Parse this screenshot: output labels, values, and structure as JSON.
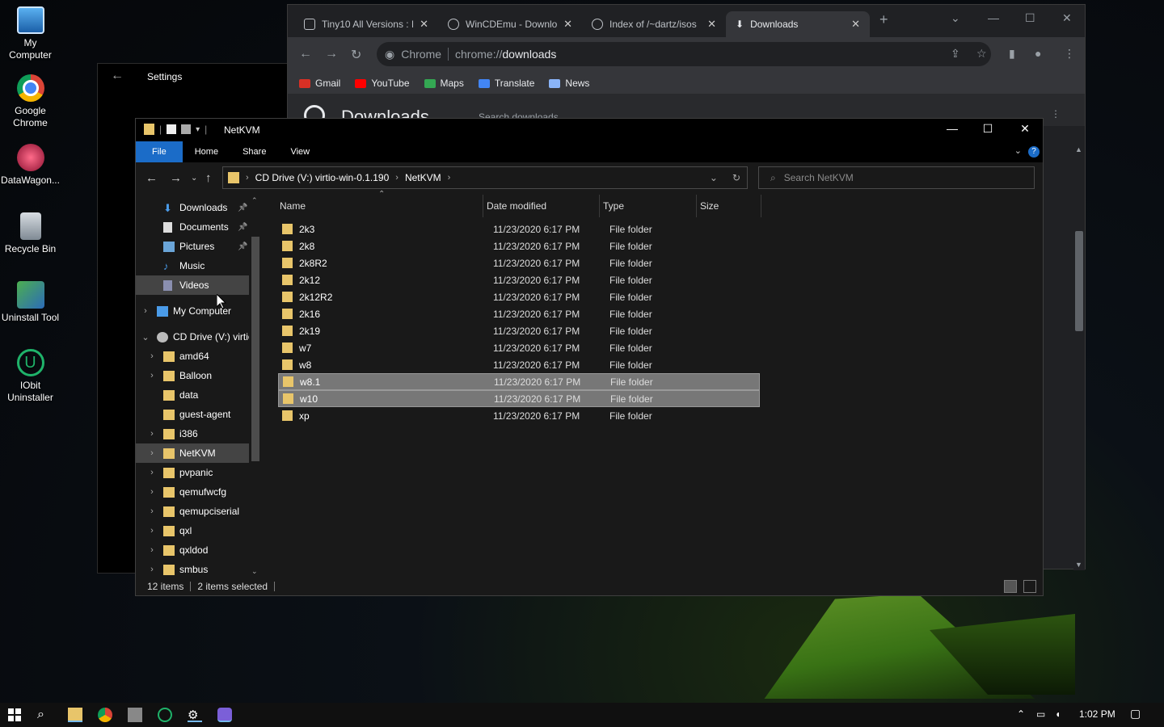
{
  "desktop": {
    "icons": [
      {
        "label_line1": "My",
        "label_line2": "Computer",
        "icon": "computer-icon"
      },
      {
        "label_line1": "Google",
        "label_line2": "Chrome",
        "icon": "chrome-icon"
      },
      {
        "label_line1": "DataWagon...",
        "label_line2": "",
        "icon": "datawagon-icon"
      },
      {
        "label_line1": "Recycle Bin",
        "label_line2": "",
        "icon": "recycle-bin-icon"
      },
      {
        "label_line1": "Uninstall Tool",
        "label_line2": "",
        "icon": "uninstall-tool-icon"
      },
      {
        "label_line1": "IObit",
        "label_line2": "Uninstaller",
        "icon": "iobit-icon"
      }
    ]
  },
  "settings": {
    "title": "Settings",
    "back": "←"
  },
  "chrome": {
    "tabs": [
      {
        "label": "Tiny10 All Versions : F",
        "close": "✕"
      },
      {
        "label": "WinCDEmu - Downlo",
        "close": "✕"
      },
      {
        "label": "Index of /~dartz/isos",
        "close": "✕"
      },
      {
        "label": "Downloads",
        "close": "✕"
      }
    ],
    "new_tab": "+",
    "omnibox": {
      "chip": "Chrome",
      "url_scheme": "chrome://",
      "url_path": "downloads"
    },
    "bookmarks": [
      "Gmail",
      "YouTube",
      "Maps",
      "Translate",
      "News"
    ],
    "page_title": "Downloads",
    "search_placeholder": "Search downloads"
  },
  "explorer": {
    "title": "NetKVM",
    "ribbon_tabs": [
      "File",
      "Home",
      "Share",
      "View"
    ],
    "help": "?",
    "breadcrumb": [
      "CD Drive (V:) virtio-win-0.1.190",
      "NetKVM"
    ],
    "search_placeholder": "Search NetKVM",
    "nav_items": [
      {
        "label": "Downloads",
        "icon": "download-icon",
        "pinned": true
      },
      {
        "label": "Documents",
        "icon": "documents-icon",
        "pinned": true
      },
      {
        "label": "Pictures",
        "icon": "pictures-icon",
        "pinned": true
      },
      {
        "label": "Music",
        "icon": "music-icon",
        "pinned": false
      },
      {
        "label": "Videos",
        "icon": "videos-icon",
        "pinned": false
      },
      {
        "label": "My Computer",
        "icon": "computer-icon"
      },
      {
        "label": "CD Drive (V:) virtio",
        "icon": "cd-drive-icon"
      },
      {
        "label": "amd64"
      },
      {
        "label": "Balloon"
      },
      {
        "label": "data"
      },
      {
        "label": "guest-agent"
      },
      {
        "label": "i386"
      },
      {
        "label": "NetKVM"
      },
      {
        "label": "pvpanic"
      },
      {
        "label": "qemufwcfg"
      },
      {
        "label": "qemupciserial"
      },
      {
        "label": "qxl"
      },
      {
        "label": "qxldod"
      },
      {
        "label": "smbus"
      }
    ],
    "columns": [
      "Name",
      "Date modified",
      "Type",
      "Size"
    ],
    "files": [
      {
        "name": "2k3",
        "date": "11/23/2020 6:17 PM",
        "type": "File folder",
        "selected": false
      },
      {
        "name": "2k8",
        "date": "11/23/2020 6:17 PM",
        "type": "File folder",
        "selected": false
      },
      {
        "name": "2k8R2",
        "date": "11/23/2020 6:17 PM",
        "type": "File folder",
        "selected": false
      },
      {
        "name": "2k12",
        "date": "11/23/2020 6:17 PM",
        "type": "File folder",
        "selected": false
      },
      {
        "name": "2k12R2",
        "date": "11/23/2020 6:17 PM",
        "type": "File folder",
        "selected": false
      },
      {
        "name": "2k16",
        "date": "11/23/2020 6:17 PM",
        "type": "File folder",
        "selected": false
      },
      {
        "name": "2k19",
        "date": "11/23/2020 6:17 PM",
        "type": "File folder",
        "selected": false
      },
      {
        "name": "w7",
        "date": "11/23/2020 6:17 PM",
        "type": "File folder",
        "selected": false
      },
      {
        "name": "w8",
        "date": "11/23/2020 6:17 PM",
        "type": "File folder",
        "selected": false
      },
      {
        "name": "w8.1",
        "date": "11/23/2020 6:17 PM",
        "type": "File folder",
        "selected": true
      },
      {
        "name": "w10",
        "date": "11/23/2020 6:17 PM",
        "type": "File folder",
        "selected": true
      },
      {
        "name": "xp",
        "date": "11/23/2020 6:17 PM",
        "type": "File folder",
        "selected": false
      }
    ],
    "status": {
      "count": "12 items",
      "selected": "2 items selected"
    }
  },
  "taskbar": {
    "time": "1:02 PM"
  },
  "colors": {
    "accent": "#1b6cc8",
    "folder": "#e8c56a",
    "selection": "#777777"
  }
}
